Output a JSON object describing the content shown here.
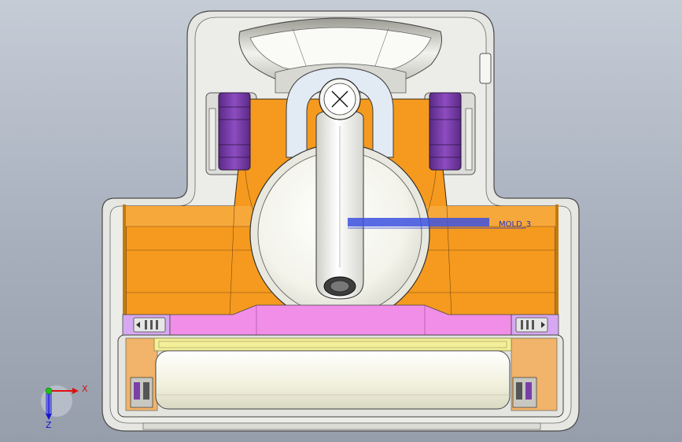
{
  "viewport": {
    "annotation_text": "MOLD_3",
    "background_colors": [
      "#c5ccd6",
      "#969eac"
    ]
  },
  "triad": {
    "x_label": "X",
    "z_label": "Z"
  },
  "colors": {
    "body_orange": "#f59a1e",
    "housing_gray": "#e3e3e0",
    "wheel_purple": "#7b3fa8",
    "strip_pink": "#f08ee8",
    "strip_lavender": "#d7a8f2",
    "yellow_rim": "#f3ef9a",
    "roller_cream": "#f3f2e2"
  }
}
